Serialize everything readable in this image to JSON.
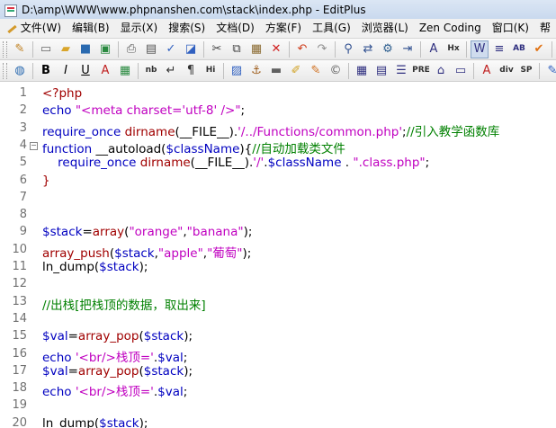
{
  "window": {
    "title": "D:\\amp\\WWW\\www.phpnanshen.com\\stack\\index.php - EditPlus"
  },
  "menu": {
    "items": [
      {
        "label": "文件(W)"
      },
      {
        "label": "编辑(B)"
      },
      {
        "label": "显示(X)"
      },
      {
        "label": "搜索(S)"
      },
      {
        "label": "文档(D)"
      },
      {
        "label": "方案(F)"
      },
      {
        "label": "工具(G)"
      },
      {
        "label": "浏览器(L)"
      },
      {
        "label": "Zen Coding"
      },
      {
        "label": "窗口(K)"
      },
      {
        "label": "帮"
      }
    ]
  },
  "toolbar1": {
    "buttons": [
      {
        "name": "pencil-icon",
        "glyph": "✎",
        "color": "#c08020"
      },
      {
        "name": "new-file-icon",
        "glyph": "▭",
        "color": "#666666"
      },
      {
        "name": "open-folder-icon",
        "glyph": "▰",
        "color": "#d9a52a"
      },
      {
        "name": "save-icon",
        "glyph": "■",
        "color": "#2a6ab0"
      },
      {
        "name": "save-all-icon",
        "glyph": "▣",
        "color": "#2a8a40"
      },
      {
        "name": "print-icon",
        "glyph": "⎙",
        "color": "#555555"
      },
      {
        "name": "print-preview-icon",
        "glyph": "▤",
        "color": "#555555"
      },
      {
        "name": "spell-check-icon",
        "glyph": "✓",
        "color": "#3060c0"
      },
      {
        "name": "html-preview-icon",
        "glyph": "◪",
        "color": "#3060c0"
      },
      {
        "name": "cut-icon",
        "glyph": "✂",
        "color": "#444444"
      },
      {
        "name": "copy-icon",
        "glyph": "⧉",
        "color": "#444444"
      },
      {
        "name": "paste-icon",
        "glyph": "▦",
        "color": "#8a6a30"
      },
      {
        "name": "delete-icon",
        "glyph": "✕",
        "color": "#d02020"
      },
      {
        "name": "undo-icon",
        "glyph": "↶",
        "color": "#d04020"
      },
      {
        "name": "redo-icon",
        "glyph": "↷",
        "color": "#909090"
      },
      {
        "name": "find-icon",
        "glyph": "⚲",
        "color": "#305090"
      },
      {
        "name": "replace-icon",
        "glyph": "⇄",
        "color": "#305090"
      },
      {
        "name": "find-in-files-icon",
        "glyph": "⚙",
        "color": "#306090"
      },
      {
        "name": "goto-icon",
        "glyph": "⇥",
        "color": "#305090"
      },
      {
        "name": "font-icon",
        "glyph": "A",
        "color": "#303080"
      },
      {
        "name": "hex-icon",
        "glyph": "Hx",
        "color": "#303030"
      },
      {
        "name": "word-wrap-icon",
        "glyph": "W",
        "color": "#303080"
      },
      {
        "name": "ruler-icon",
        "glyph": "≡",
        "color": "#303080"
      },
      {
        "name": "column-select-icon",
        "glyph": "AB",
        "color": "#303080"
      },
      {
        "name": "check-icon",
        "glyph": "✔",
        "color": "#e07010"
      },
      {
        "name": "monitor-icon",
        "glyph": "▭",
        "color": "#303080"
      },
      {
        "name": "panel-icon",
        "glyph": "▥",
        "color": "#303080"
      }
    ]
  },
  "toolbar2": {
    "buttons": [
      {
        "name": "globe-icon",
        "glyph": "◍",
        "color": "#2a6ab0"
      },
      {
        "name": "bold-icon",
        "glyph": "B",
        "color": "#000000"
      },
      {
        "name": "italic-icon",
        "glyph": "I",
        "color": "#000000"
      },
      {
        "name": "underline-icon",
        "glyph": "U",
        "color": "#000000"
      },
      {
        "name": "font-color-icon",
        "glyph": "A",
        "color": "#c02020"
      },
      {
        "name": "color-grid-icon",
        "glyph": "▦",
        "color": "#2a8a40"
      },
      {
        "name": "nbsp-icon",
        "glyph": "nb",
        "color": "#303030"
      },
      {
        "name": "br-icon",
        "glyph": "↵",
        "color": "#303030"
      },
      {
        "name": "paragraph-icon",
        "glyph": "¶",
        "color": "#303030"
      },
      {
        "name": "heading-icon",
        "glyph": "Hi",
        "color": "#303030"
      },
      {
        "name": "image-icon",
        "glyph": "▨",
        "color": "#3060c0"
      },
      {
        "name": "anchor-icon",
        "glyph": "⚓",
        "color": "#a06020"
      },
      {
        "name": "hr-icon",
        "glyph": "▬",
        "color": "#606060"
      },
      {
        "name": "marker-icon",
        "glyph": "✐",
        "color": "#d0a020"
      },
      {
        "name": "edit-tag-icon",
        "glyph": "✎",
        "color": "#d07020"
      },
      {
        "name": "copyright-icon",
        "glyph": "©",
        "color": "#606060"
      },
      {
        "name": "table-icon",
        "glyph": "▦",
        "color": "#303080"
      },
      {
        "name": "form-icon",
        "glyph": "▤",
        "color": "#303080"
      },
      {
        "name": "list-icon",
        "glyph": "☰",
        "color": "#303080"
      },
      {
        "name": "pre-icon",
        "glyph": "PRE",
        "color": "#303030"
      },
      {
        "name": "tag-icon",
        "glyph": "⌂",
        "color": "#303080"
      },
      {
        "name": "input-icon",
        "glyph": "▭",
        "color": "#303080"
      },
      {
        "name": "font-tag-icon",
        "glyph": "A",
        "color": "#c02020"
      },
      {
        "name": "div-icon",
        "glyph": "div",
        "color": "#303030"
      },
      {
        "name": "span-icon",
        "glyph": "SP",
        "color": "#303030"
      },
      {
        "name": "script-icon",
        "glyph": "✎",
        "color": "#3060c0"
      },
      {
        "name": "brush-icon",
        "glyph": "✐",
        "color": "#d07020"
      },
      {
        "name": "eraser-icon",
        "glyph": "◆",
        "color": "#c02020"
      }
    ]
  },
  "editor": {
    "lines": [
      {
        "n": "1",
        "fold": "",
        "tokens": [
          {
            "t": "<?php",
            "c": "php"
          }
        ]
      },
      {
        "n": "2",
        "fold": "",
        "tokens": [
          {
            "t": "echo ",
            "c": "kw"
          },
          {
            "t": "\"<meta charset='utf-8' />\"",
            "c": "str"
          },
          {
            "t": ";",
            "c": "plain"
          }
        ]
      },
      {
        "n": "3",
        "fold": "",
        "tokens": [
          {
            "t": "require_once ",
            "c": "kw"
          },
          {
            "t": "dirname",
            "c": "fn"
          },
          {
            "t": "(__FILE__).",
            "c": "plain"
          },
          {
            "t": "'/../Functions/common.php'",
            "c": "str"
          },
          {
            "t": ";",
            "c": "plain"
          },
          {
            "t": "//引入教学函数库",
            "c": "cmt"
          }
        ]
      },
      {
        "n": "4",
        "fold": "⊟",
        "tokens": [
          {
            "t": "function ",
            "c": "kw"
          },
          {
            "t": "__autoload(",
            "c": "plain"
          },
          {
            "t": "$className",
            "c": "var"
          },
          {
            "t": "){",
            "c": "plain"
          },
          {
            "t": "//自动加载类文件",
            "c": "cmt"
          }
        ]
      },
      {
        "n": "5",
        "fold": "",
        "tokens": [
          {
            "t": "    require_once ",
            "c": "kw"
          },
          {
            "t": "dirname",
            "c": "fn"
          },
          {
            "t": "(__FILE__).",
            "c": "plain"
          },
          {
            "t": "'/'",
            "c": "str"
          },
          {
            "t": ".",
            "c": "plain"
          },
          {
            "t": "$className",
            "c": "var"
          },
          {
            "t": " . ",
            "c": "plain"
          },
          {
            "t": "\".class.php\"",
            "c": "str"
          },
          {
            "t": ";",
            "c": "plain"
          }
        ]
      },
      {
        "n": "6",
        "fold": "",
        "tokens": [
          {
            "t": "}",
            "c": "fn"
          }
        ]
      },
      {
        "n": "7",
        "fold": "",
        "tokens": []
      },
      {
        "n": "8",
        "fold": "",
        "tokens": []
      },
      {
        "n": "9",
        "fold": "",
        "tokens": [
          {
            "t": "$stack",
            "c": "var"
          },
          {
            "t": "=",
            "c": "plain"
          },
          {
            "t": "array",
            "c": "fn"
          },
          {
            "t": "(",
            "c": "plain"
          },
          {
            "t": "\"orange\"",
            "c": "str"
          },
          {
            "t": ",",
            "c": "plain"
          },
          {
            "t": "\"banana\"",
            "c": "str"
          },
          {
            "t": ");",
            "c": "plain"
          }
        ]
      },
      {
        "n": "10",
        "fold": "",
        "tokens": [
          {
            "t": "array_push",
            "c": "fn"
          },
          {
            "t": "(",
            "c": "plain"
          },
          {
            "t": "$stack",
            "c": "var"
          },
          {
            "t": ",",
            "c": "plain"
          },
          {
            "t": "\"apple\"",
            "c": "str"
          },
          {
            "t": ",",
            "c": "plain"
          },
          {
            "t": "\"葡萄\"",
            "c": "str"
          },
          {
            "t": ");",
            "c": "plain"
          }
        ]
      },
      {
        "n": "11",
        "fold": "",
        "tokens": [
          {
            "t": "ln_dump(",
            "c": "plain"
          },
          {
            "t": "$stack",
            "c": "var"
          },
          {
            "t": ");",
            "c": "plain"
          }
        ]
      },
      {
        "n": "12",
        "fold": "",
        "tokens": []
      },
      {
        "n": "13",
        "fold": "",
        "tokens": [
          {
            "t": "//出栈[把栈顶的数据，取出来]",
            "c": "cmt"
          }
        ]
      },
      {
        "n": "14",
        "fold": "",
        "tokens": []
      },
      {
        "n": "15",
        "fold": "",
        "tokens": [
          {
            "t": "$val",
            "c": "var"
          },
          {
            "t": "=",
            "c": "plain"
          },
          {
            "t": "array_pop",
            "c": "fn"
          },
          {
            "t": "(",
            "c": "plain"
          },
          {
            "t": "$stack",
            "c": "var"
          },
          {
            "t": ");",
            "c": "plain"
          }
        ]
      },
      {
        "n": "16",
        "fold": "",
        "tokens": [
          {
            "t": "echo ",
            "c": "kw"
          },
          {
            "t": "'<br/>栈顶='",
            "c": "str"
          },
          {
            "t": ".",
            "c": "plain"
          },
          {
            "t": "$val",
            "c": "var"
          },
          {
            "t": ";",
            "c": "plain"
          }
        ]
      },
      {
        "n": "17",
        "fold": "",
        "tokens": [
          {
            "t": "$val",
            "c": "var"
          },
          {
            "t": "=",
            "c": "plain"
          },
          {
            "t": "array_pop",
            "c": "fn"
          },
          {
            "t": "(",
            "c": "plain"
          },
          {
            "t": "$stack",
            "c": "var"
          },
          {
            "t": ");",
            "c": "plain"
          }
        ]
      },
      {
        "n": "18",
        "fold": "",
        "tokens": [
          {
            "t": "echo ",
            "c": "kw"
          },
          {
            "t": "'<br/>栈顶='",
            "c": "str"
          },
          {
            "t": ".",
            "c": "plain"
          },
          {
            "t": "$val",
            "c": "var"
          },
          {
            "t": ";",
            "c": "plain"
          }
        ]
      },
      {
        "n": "19",
        "fold": "",
        "tokens": []
      },
      {
        "n": "20",
        "fold": "",
        "tokens": [
          {
            "t": "ln_dump(",
            "c": "plain"
          },
          {
            "t": "$stack",
            "c": "var"
          },
          {
            "t": ");",
            "c": "plain"
          }
        ]
      }
    ]
  }
}
